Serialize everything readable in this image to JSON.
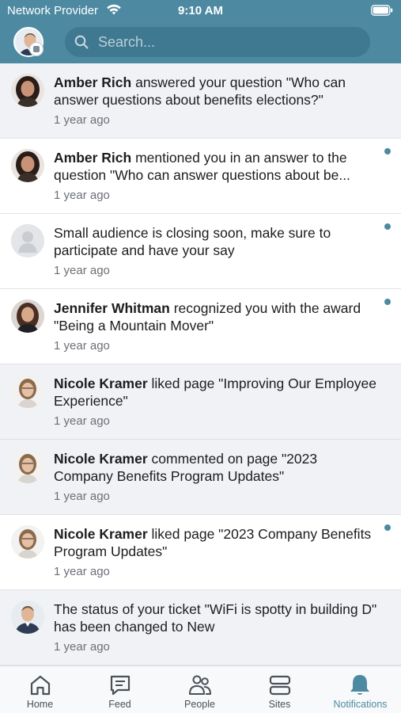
{
  "status_bar": {
    "carrier": "Network Provider",
    "time": "9:10 AM"
  },
  "search": {
    "placeholder": "Search..."
  },
  "notifications": [
    {
      "actor": "Amber Rich",
      "text": " answered your question \"Who can answer questions about benefits elections?\"",
      "time": "1 year ago",
      "unread": false
    },
    {
      "actor": "Amber Rich",
      "text": " mentioned you in an answer to the question \"Who can answer questions about be...",
      "time": "1 year ago",
      "unread": true
    },
    {
      "actor": "",
      "text": "Small audience is closing soon, make sure to participate and have your say",
      "time": "1 year ago",
      "unread": true
    },
    {
      "actor": "Jennifer Whitman",
      "text": " recognized you with the award \"Being a Mountain Mover\"",
      "time": "1 year ago",
      "unread": true
    },
    {
      "actor": "Nicole Kramer",
      "text": " liked page  \"Improving Our Employee Experience\"",
      "time": "1 year ago",
      "unread": false
    },
    {
      "actor": "Nicole Kramer",
      "text": " commented on page  \"2023 Company Benefits Program Updates\"",
      "time": "1 year ago",
      "unread": false
    },
    {
      "actor": "Nicole Kramer",
      "text": " liked page  \"2023 Company Benefits Program Updates\"",
      "time": "1 year ago",
      "unread": true
    },
    {
      "actor": "",
      "text": "The status of your ticket \"WiFi is spotty in building D\" has been changed to New",
      "time": "1 year ago",
      "unread": false
    }
  ],
  "tabs": [
    {
      "label": "Home",
      "icon": "home-icon"
    },
    {
      "label": "Feed",
      "icon": "feed-icon"
    },
    {
      "label": "People",
      "icon": "people-icon"
    },
    {
      "label": "Sites",
      "icon": "sites-icon"
    },
    {
      "label": "Notifications",
      "icon": "bell-icon"
    }
  ],
  "colors": {
    "header": "#4d8aa2",
    "search": "#3f7891",
    "accent": "#4d8aa2",
    "read_row": "#f1f2f5"
  }
}
